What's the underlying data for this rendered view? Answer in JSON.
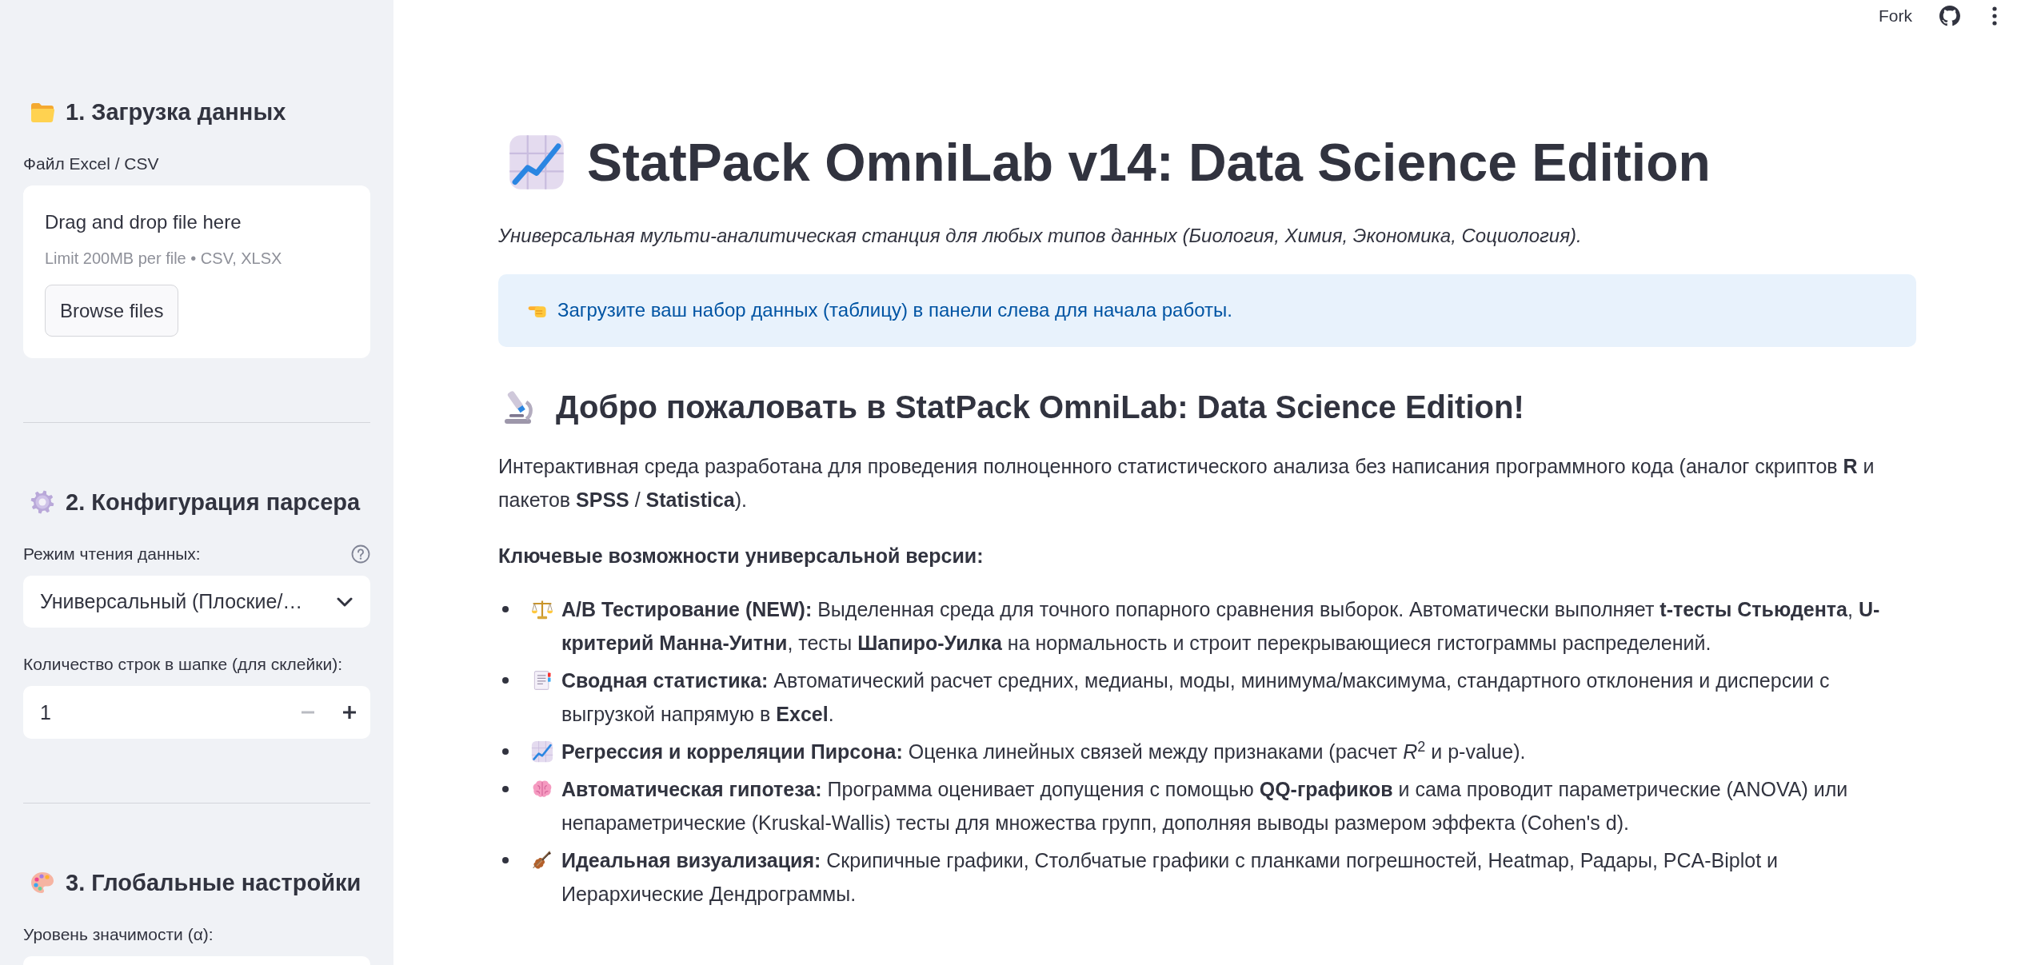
{
  "header": {
    "fork_label": "Fork"
  },
  "sidebar": {
    "sections": [
      {
        "title": "1. Загрузка данных",
        "widgets": [
          {
            "kind": "uploader",
            "label": "Файл Excel / CSV",
            "dropzone_text": "Drag and drop file here",
            "limit_text": "Limit 200MB per file • CSV, XLSX",
            "button": "Browse files"
          }
        ]
      },
      {
        "title": "2. Конфигурация парсера",
        "widgets": [
          {
            "kind": "select",
            "label": "Режим чтения данных:",
            "help": true,
            "value": "Универсальный (Плоские/…"
          },
          {
            "kind": "number",
            "label": "Количество строк в шапке (для склейки):",
            "value": "1",
            "decrement_disabled": true
          }
        ]
      },
      {
        "title": "3. Глобальные настройки",
        "widgets": [
          {
            "kind": "field",
            "label": "Уровень значимости (α):"
          }
        ]
      }
    ]
  },
  "main": {
    "title": "StatPack OmniLab v14: Data Science Edition",
    "subtitle": "Универсальная мульти-аналитическая станция для любых типов данных (Биология, Химия, Экономика, Социология).",
    "info": "Загрузите ваш набор данных (таблицу) в панели слева для начала работы.",
    "welcome": {
      "heading": "Добро пожаловать в StatPack OmniLab: Data Science Edition!",
      "paragraph": "Интерактивная среда разработана для проведения полноценного статистического анализа без написания программного кода (аналог скриптов **R** и пакетов **SPSS** / **Statistica**).",
      "features_heading": "Ключевые возможности универсальной версии:",
      "features": [
        {
          "text": "**A/B Тестирование (NEW):** Выделенная среда для точного попарного сравнения выборок. Автоматически выполняет **t-тесты Стьюдента**, **U-критерий Манна-Уитни**, тесты **Шапиро-Уилка** на нормальность и строит перекрывающиеся гистограммы распределений."
        },
        {
          "text": "**Сводная статистика:** Автоматический расчет средних, медианы, моды, минимума/максимума, стандартного отклонения и дисперсии с выгрузкой напрямую в **Excel**."
        },
        {
          "text": "**Регрессия и корреляции Пирсона:** Оценка линейных связей между признаками (расчет *R*$^{2}$ и p-value)."
        },
        {
          "text": "**Автоматическая гипотеза:** Программа оценивает допущения с помощью **QQ-графиков** и сама проводит параметрические (ANOVA) или непараметрические (Kruskal-Wallis) тесты для множества групп, дополняя выводы размером эффекта (Cohen's d)."
        },
        {
          "text": "**Идеальная визуализация:** Скрипичные графики, Столбчатые графики с планками погрешностей, Heatmap, Радары, PCA-Biplot и Иерархические Дендрограммы."
        }
      ]
    }
  }
}
